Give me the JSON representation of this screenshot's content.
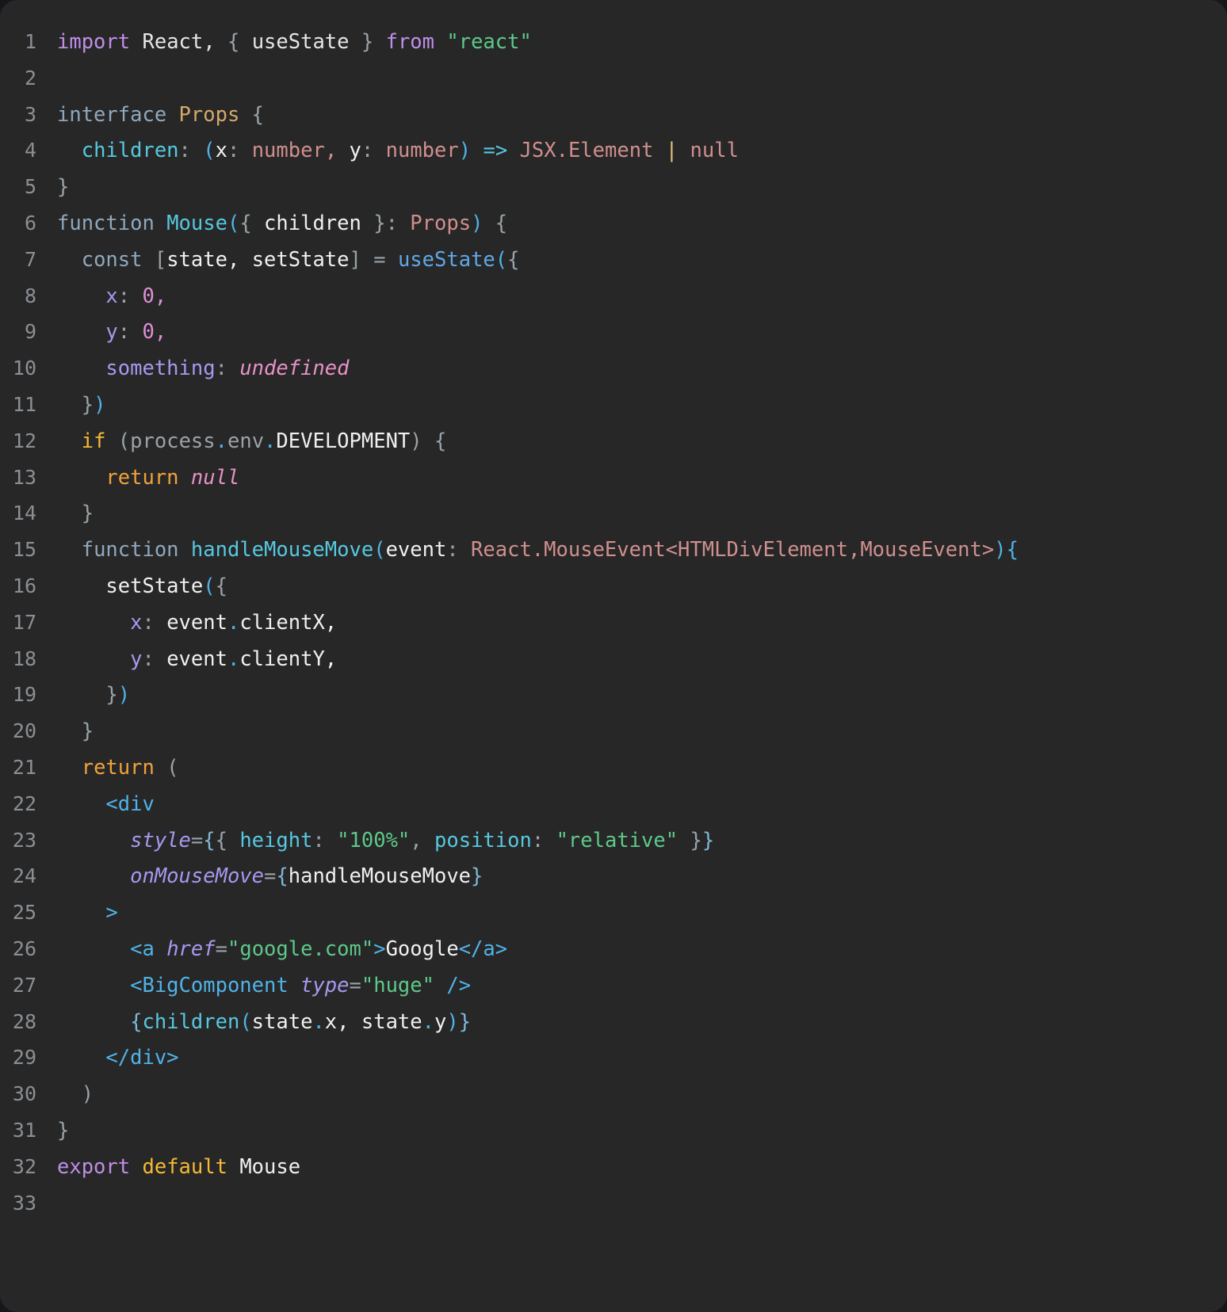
{
  "editor": {
    "theme": "dark",
    "background_color": "#272727",
    "gutter_color": "#8b8f94",
    "total_lines": 33,
    "language": "tsx",
    "filename_inferred": "Mouse"
  },
  "palette": {
    "keyword_purple": "#c08ee8",
    "string_green": "#5dc98a",
    "type_salmon": "#d08f8f",
    "cyan": "#56c8e0",
    "blue": "#4fb3e8",
    "yellow": "#e5c07b",
    "amber": "#f5b935",
    "orange": "#f0a23c",
    "pink": "#e892c8",
    "lavender": "#a998f0",
    "plain": "#e6e6e6",
    "dim": "#9aa3a8"
  },
  "line_numbers": [
    "1",
    "2",
    "3",
    "4",
    "5",
    "6",
    "7",
    "8",
    "9",
    "10",
    "11",
    "12",
    "13",
    "14",
    "15",
    "16",
    "17",
    "18",
    "19",
    "20",
    "21",
    "22",
    "23",
    "24",
    "25",
    "26",
    "27",
    "28",
    "29",
    "30",
    "31",
    "32",
    "33"
  ],
  "code_lines": [
    {
      "n": "1",
      "tokens": [
        {
          "t": "import",
          "c": "t-kw"
        },
        {
          "t": " ",
          "c": "t-plain"
        },
        {
          "t": "React",
          "c": "t-plain"
        },
        {
          "t": ",",
          "c": "t-plain"
        },
        {
          "t": " ",
          "c": "t-plain"
        },
        {
          "t": "{",
          "c": "t-punct"
        },
        {
          "t": " ",
          "c": "t-plain"
        },
        {
          "t": "useState",
          "c": "t-plain"
        },
        {
          "t": " ",
          "c": "t-plain"
        },
        {
          "t": "}",
          "c": "t-punct"
        },
        {
          "t": " ",
          "c": "t-plain"
        },
        {
          "t": "from",
          "c": "t-kw"
        },
        {
          "t": " ",
          "c": "t-plain"
        },
        {
          "t": "\"react\"",
          "c": "t-str"
        }
      ]
    },
    {
      "n": "2",
      "tokens": []
    },
    {
      "n": "3",
      "tokens": [
        {
          "t": "interface",
          "c": "t-iface"
        },
        {
          "t": " ",
          "c": "t-plain"
        },
        {
          "t": "Props",
          "c": "t-type"
        },
        {
          "t": " ",
          "c": "t-plain"
        },
        {
          "t": "{",
          "c": "t-punct"
        }
      ]
    },
    {
      "n": "4",
      "tokens": [
        {
          "t": "  ",
          "c": "t-plain"
        },
        {
          "t": "children",
          "c": "t-prop"
        },
        {
          "t": ":",
          "c": "t-punct"
        },
        {
          "t": " ",
          "c": "t-plain"
        },
        {
          "t": "(",
          "c": "t-paren"
        },
        {
          "t": "x",
          "c": "t-white"
        },
        {
          "t": ":",
          "c": "t-punct"
        },
        {
          "t": " ",
          "c": "t-plain"
        },
        {
          "t": "number",
          "c": "t-num"
        },
        {
          "t": ",",
          "c": "t-num"
        },
        {
          "t": " ",
          "c": "t-plain"
        },
        {
          "t": "y",
          "c": "t-white"
        },
        {
          "t": ":",
          "c": "t-punct"
        },
        {
          "t": " ",
          "c": "t-plain"
        },
        {
          "t": "number",
          "c": "t-num"
        },
        {
          "t": ")",
          "c": "t-paren"
        },
        {
          "t": " ",
          "c": "t-plain"
        },
        {
          "t": "=>",
          "c": "t-arrow"
        },
        {
          "t": " ",
          "c": "t-plain"
        },
        {
          "t": "JSX.Element",
          "c": "t-salmon"
        },
        {
          "t": " ",
          "c": "t-plain"
        },
        {
          "t": "|",
          "c": "t-pipe"
        },
        {
          "t": " ",
          "c": "t-plain"
        },
        {
          "t": "null",
          "c": "t-salmon"
        }
      ]
    },
    {
      "n": "5",
      "tokens": [
        {
          "t": "}",
          "c": "t-punct"
        }
      ]
    },
    {
      "n": "6",
      "tokens": [
        {
          "t": "function",
          "c": "t-iface"
        },
        {
          "t": " ",
          "c": "t-plain"
        },
        {
          "t": "Mouse",
          "c": "t-fn"
        },
        {
          "t": "(",
          "c": "t-paren"
        },
        {
          "t": "{",
          "c": "t-punct"
        },
        {
          "t": " ",
          "c": "t-plain"
        },
        {
          "t": "children",
          "c": "t-white"
        },
        {
          "t": " ",
          "c": "t-plain"
        },
        {
          "t": "}",
          "c": "t-punct"
        },
        {
          "t": ":",
          "c": "t-punct"
        },
        {
          "t": " ",
          "c": "t-plain"
        },
        {
          "t": "Props",
          "c": "t-salmon"
        },
        {
          "t": ")",
          "c": "t-paren"
        },
        {
          "t": " ",
          "c": "t-plain"
        },
        {
          "t": "{",
          "c": "t-punct"
        }
      ]
    },
    {
      "n": "7",
      "tokens": [
        {
          "t": "  ",
          "c": "t-plain"
        },
        {
          "t": "const",
          "c": "t-iface"
        },
        {
          "t": " ",
          "c": "t-plain"
        },
        {
          "t": "[",
          "c": "t-punct"
        },
        {
          "t": "state",
          "c": "t-white"
        },
        {
          "t": ",",
          "c": "t-white"
        },
        {
          "t": " ",
          "c": "t-plain"
        },
        {
          "t": "setState",
          "c": "t-white"
        },
        {
          "t": "]",
          "c": "t-punct"
        },
        {
          "t": " ",
          "c": "t-plain"
        },
        {
          "t": "=",
          "c": "t-gray"
        },
        {
          "t": " ",
          "c": "t-plain"
        },
        {
          "t": "useState",
          "c": "t-hook"
        },
        {
          "t": "(",
          "c": "t-paren"
        },
        {
          "t": "{",
          "c": "t-punct"
        }
      ]
    },
    {
      "n": "8",
      "tokens": [
        {
          "t": "    ",
          "c": "t-plain"
        },
        {
          "t": "x",
          "c": "t-key"
        },
        {
          "t": ":",
          "c": "t-punct"
        },
        {
          "t": " ",
          "c": "t-plain"
        },
        {
          "t": "0",
          "c": "t-zero"
        },
        {
          "t": ",",
          "c": "t-zero"
        }
      ]
    },
    {
      "n": "9",
      "tokens": [
        {
          "t": "    ",
          "c": "t-plain"
        },
        {
          "t": "y",
          "c": "t-key"
        },
        {
          "t": ":",
          "c": "t-punct"
        },
        {
          "t": " ",
          "c": "t-plain"
        },
        {
          "t": "0",
          "c": "t-zero"
        },
        {
          "t": ",",
          "c": "t-zero"
        }
      ]
    },
    {
      "n": "10",
      "tokens": [
        {
          "t": "    ",
          "c": "t-plain"
        },
        {
          "t": "something",
          "c": "t-key"
        },
        {
          "t": ":",
          "c": "t-punct"
        },
        {
          "t": " ",
          "c": "t-plain"
        },
        {
          "t": "undefined",
          "c": "t-undef"
        }
      ]
    },
    {
      "n": "11",
      "tokens": [
        {
          "t": "  ",
          "c": "t-plain"
        },
        {
          "t": "}",
          "c": "t-punct"
        },
        {
          "t": ")",
          "c": "t-paren"
        }
      ]
    },
    {
      "n": "12",
      "tokens": [
        {
          "t": "  ",
          "c": "t-plain"
        },
        {
          "t": "if",
          "c": "t-if"
        },
        {
          "t": " ",
          "c": "t-plain"
        },
        {
          "t": "(",
          "c": "t-punct"
        },
        {
          "t": "process",
          "c": "t-gray"
        },
        {
          "t": ".",
          "c": "t-paren"
        },
        {
          "t": "env",
          "c": "t-gray"
        },
        {
          "t": ".",
          "c": "t-paren"
        },
        {
          "t": "DEVELOPMENT",
          "c": "t-white"
        },
        {
          "t": ")",
          "c": "t-punct"
        },
        {
          "t": " ",
          "c": "t-plain"
        },
        {
          "t": "{",
          "c": "t-punct"
        }
      ]
    },
    {
      "n": "13",
      "tokens": [
        {
          "t": "    ",
          "c": "t-plain"
        },
        {
          "t": "return",
          "c": "t-return"
        },
        {
          "t": " ",
          "c": "t-plain"
        },
        {
          "t": "null",
          "c": "t-nullv"
        }
      ]
    },
    {
      "n": "14",
      "tokens": [
        {
          "t": "  ",
          "c": "t-plain"
        },
        {
          "t": "}",
          "c": "t-punct"
        }
      ]
    },
    {
      "n": "15",
      "tokens": [
        {
          "t": "  ",
          "c": "t-plain"
        },
        {
          "t": "function",
          "c": "t-iface"
        },
        {
          "t": " ",
          "c": "t-plain"
        },
        {
          "t": "handleMouseMove",
          "c": "t-fn"
        },
        {
          "t": "(",
          "c": "t-paren"
        },
        {
          "t": "event",
          "c": "t-white"
        },
        {
          "t": ":",
          "c": "t-punct"
        },
        {
          "t": " ",
          "c": "t-plain"
        },
        {
          "t": "React.MouseEvent<HTMLDivElement,MouseEvent>",
          "c": "t-salmon"
        },
        {
          "t": ")",
          "c": "t-paren"
        },
        {
          "t": "{",
          "c": "t-paren"
        }
      ]
    },
    {
      "n": "16",
      "tokens": [
        {
          "t": "    ",
          "c": "t-plain"
        },
        {
          "t": "setState",
          "c": "t-white"
        },
        {
          "t": "(",
          "c": "t-paren"
        },
        {
          "t": "{",
          "c": "t-punct"
        }
      ]
    },
    {
      "n": "17",
      "tokens": [
        {
          "t": "      ",
          "c": "t-plain"
        },
        {
          "t": "x",
          "c": "t-key"
        },
        {
          "t": ":",
          "c": "t-punct"
        },
        {
          "t": " ",
          "c": "t-plain"
        },
        {
          "t": "event",
          "c": "t-white"
        },
        {
          "t": ".",
          "c": "t-paren"
        },
        {
          "t": "clientX",
          "c": "t-white"
        },
        {
          "t": ",",
          "c": "t-white"
        }
      ]
    },
    {
      "n": "18",
      "tokens": [
        {
          "t": "      ",
          "c": "t-plain"
        },
        {
          "t": "y",
          "c": "t-key"
        },
        {
          "t": ":",
          "c": "t-punct"
        },
        {
          "t": " ",
          "c": "t-plain"
        },
        {
          "t": "event",
          "c": "t-white"
        },
        {
          "t": ".",
          "c": "t-paren"
        },
        {
          "t": "clientY",
          "c": "t-white"
        },
        {
          "t": ",",
          "c": "t-white"
        }
      ]
    },
    {
      "n": "19",
      "tokens": [
        {
          "t": "    ",
          "c": "t-plain"
        },
        {
          "t": "}",
          "c": "t-punct"
        },
        {
          "t": ")",
          "c": "t-paren"
        }
      ]
    },
    {
      "n": "20",
      "tokens": [
        {
          "t": "  ",
          "c": "t-plain"
        },
        {
          "t": "}",
          "c": "t-punct"
        }
      ]
    },
    {
      "n": "21",
      "tokens": [
        {
          "t": "  ",
          "c": "t-plain"
        },
        {
          "t": "return",
          "c": "t-return"
        },
        {
          "t": " ",
          "c": "t-plain"
        },
        {
          "t": "(",
          "c": "t-punct"
        }
      ]
    },
    {
      "n": "22",
      "tokens": [
        {
          "t": "    ",
          "c": "t-plain"
        },
        {
          "t": "<div",
          "c": "t-tag"
        }
      ]
    },
    {
      "n": "23",
      "tokens": [
        {
          "t": "      ",
          "c": "t-plain"
        },
        {
          "t": "style",
          "c": "t-attr"
        },
        {
          "t": "=",
          "c": "t-eq"
        },
        {
          "t": "{",
          "c": "t-brace"
        },
        {
          "t": "{",
          "c": "t-punct"
        },
        {
          "t": " ",
          "c": "t-plain"
        },
        {
          "t": "height",
          "c": "t-prop"
        },
        {
          "t": ":",
          "c": "t-punct"
        },
        {
          "t": " ",
          "c": "t-plain"
        },
        {
          "t": "\"100%\"",
          "c": "t-str"
        },
        {
          "t": ",",
          "c": "t-punct"
        },
        {
          "t": " ",
          "c": "t-plain"
        },
        {
          "t": "position",
          "c": "t-prop"
        },
        {
          "t": ":",
          "c": "t-punct"
        },
        {
          "t": " ",
          "c": "t-plain"
        },
        {
          "t": "\"relative\"",
          "c": "t-str"
        },
        {
          "t": " ",
          "c": "t-plain"
        },
        {
          "t": "}",
          "c": "t-punct"
        },
        {
          "t": "}",
          "c": "t-brace"
        }
      ]
    },
    {
      "n": "24",
      "tokens": [
        {
          "t": "      ",
          "c": "t-plain"
        },
        {
          "t": "onMouseMove",
          "c": "t-attr"
        },
        {
          "t": "=",
          "c": "t-eq"
        },
        {
          "t": "{",
          "c": "t-brace"
        },
        {
          "t": "handleMouseMove",
          "c": "t-white"
        },
        {
          "t": "}",
          "c": "t-brace"
        }
      ]
    },
    {
      "n": "25",
      "tokens": [
        {
          "t": "    ",
          "c": "t-plain"
        },
        {
          "t": ">",
          "c": "t-tag"
        }
      ]
    },
    {
      "n": "26",
      "tokens": [
        {
          "t": "      ",
          "c": "t-plain"
        },
        {
          "t": "<a",
          "c": "t-tag"
        },
        {
          "t": " ",
          "c": "t-plain"
        },
        {
          "t": "href",
          "c": "t-attr"
        },
        {
          "t": "=",
          "c": "t-eq"
        },
        {
          "t": "\"google.com\"",
          "c": "t-str"
        },
        {
          "t": ">",
          "c": "t-tag"
        },
        {
          "t": "Google",
          "c": "t-white"
        },
        {
          "t": "</a>",
          "c": "t-tag"
        }
      ]
    },
    {
      "n": "27",
      "tokens": [
        {
          "t": "      ",
          "c": "t-plain"
        },
        {
          "t": "<BigComponent",
          "c": "t-tag"
        },
        {
          "t": " ",
          "c": "t-plain"
        },
        {
          "t": "type",
          "c": "t-attr"
        },
        {
          "t": "=",
          "c": "t-eq"
        },
        {
          "t": "\"huge\"",
          "c": "t-str"
        },
        {
          "t": " ",
          "c": "t-plain"
        },
        {
          "t": "/>",
          "c": "t-tag"
        }
      ]
    },
    {
      "n": "28",
      "tokens": [
        {
          "t": "      ",
          "c": "t-plain"
        },
        {
          "t": "{",
          "c": "t-brace"
        },
        {
          "t": "children",
          "c": "t-prop"
        },
        {
          "t": "(",
          "c": "t-paren"
        },
        {
          "t": "state",
          "c": "t-white"
        },
        {
          "t": ".",
          "c": "t-paren"
        },
        {
          "t": "x",
          "c": "t-white"
        },
        {
          "t": ",",
          "c": "t-white"
        },
        {
          "t": " ",
          "c": "t-plain"
        },
        {
          "t": "state",
          "c": "t-white"
        },
        {
          "t": ".",
          "c": "t-paren"
        },
        {
          "t": "y",
          "c": "t-white"
        },
        {
          "t": ")",
          "c": "t-paren"
        },
        {
          "t": "}",
          "c": "t-brace"
        }
      ]
    },
    {
      "n": "29",
      "tokens": [
        {
          "t": "    ",
          "c": "t-plain"
        },
        {
          "t": "</div>",
          "c": "t-tag"
        }
      ]
    },
    {
      "n": "30",
      "tokens": [
        {
          "t": "  ",
          "c": "t-plain"
        },
        {
          "t": ")",
          "c": "t-punct"
        }
      ]
    },
    {
      "n": "31",
      "tokens": [
        {
          "t": "}",
          "c": "t-punct"
        }
      ]
    },
    {
      "n": "32",
      "tokens": [
        {
          "t": "export",
          "c": "t-kw"
        },
        {
          "t": " ",
          "c": "t-plain"
        },
        {
          "t": "default",
          "c": "t-if"
        },
        {
          "t": " ",
          "c": "t-plain"
        },
        {
          "t": "Mouse",
          "c": "t-white"
        }
      ]
    },
    {
      "n": "33",
      "tokens": []
    }
  ]
}
